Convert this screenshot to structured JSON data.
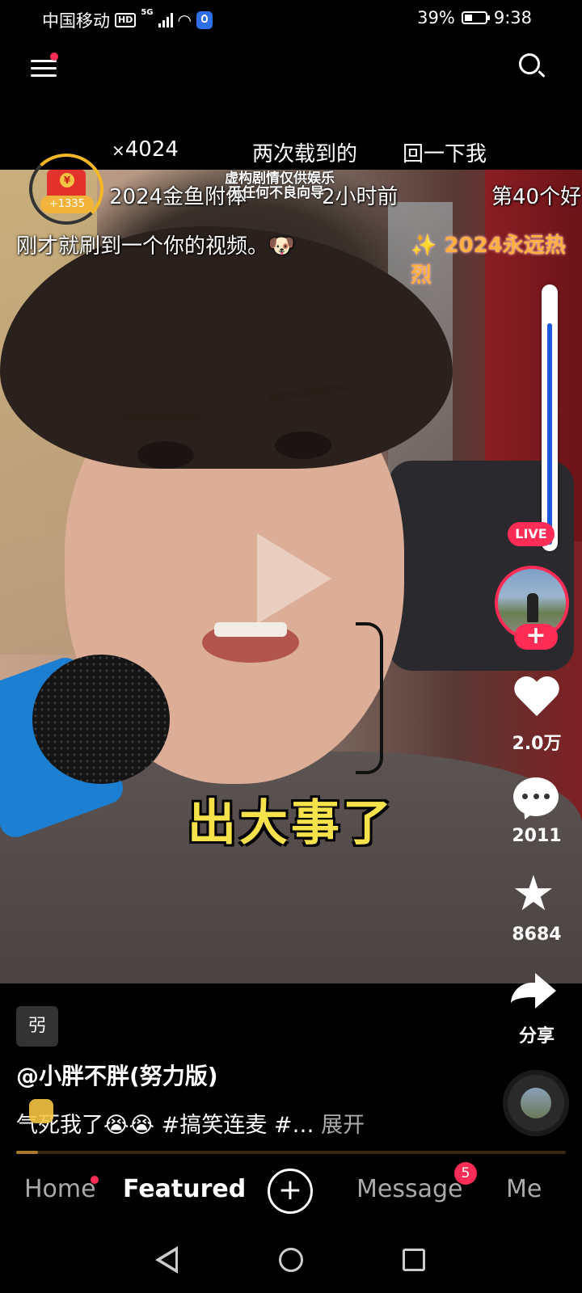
{
  "status_bar": {
    "carrier": "中国移动",
    "hd": "HD",
    "network": "5G",
    "battery_percent_text": "39%",
    "battery_level": 0.39,
    "time": "9:38"
  },
  "danmaku": {
    "row1": [
      "4024",
      "两次载到的",
      "回一下我"
    ],
    "row1_prefix": "×",
    "row2": [
      "2024金鱼附体",
      "2小时前",
      "第40个好"
    ],
    "row3": "刚才就刷到一个你的视频。🐶",
    "sparkle_text": "2024永远热烈"
  },
  "video_notice": {
    "line1": "虚构剧情仅供娱乐",
    "line2": "无任何不良向导"
  },
  "video": {
    "caption": "出大事了"
  },
  "red_packet": {
    "count": "+1335"
  },
  "creator": {
    "live_badge": "LIVE",
    "follow_label": "+"
  },
  "actions": {
    "likes": "2.0万",
    "comments": "2011",
    "favorites": "8684",
    "share": "分享"
  },
  "post": {
    "tag_chip": "弜",
    "author": "@小胖不胖(努力版)",
    "description": "气死我了😭😭 #搞笑连麦 #…",
    "expand": "展开",
    "progress": 0.04
  },
  "tabs": {
    "home": "Home",
    "featured": "Featured",
    "message": "Message",
    "message_badge": "5",
    "me": "Me",
    "create": "+"
  },
  "colors": {
    "accent": "#ff2c55",
    "caption": "#f6e24b",
    "scroll_thumb": "#1a5ae0"
  }
}
